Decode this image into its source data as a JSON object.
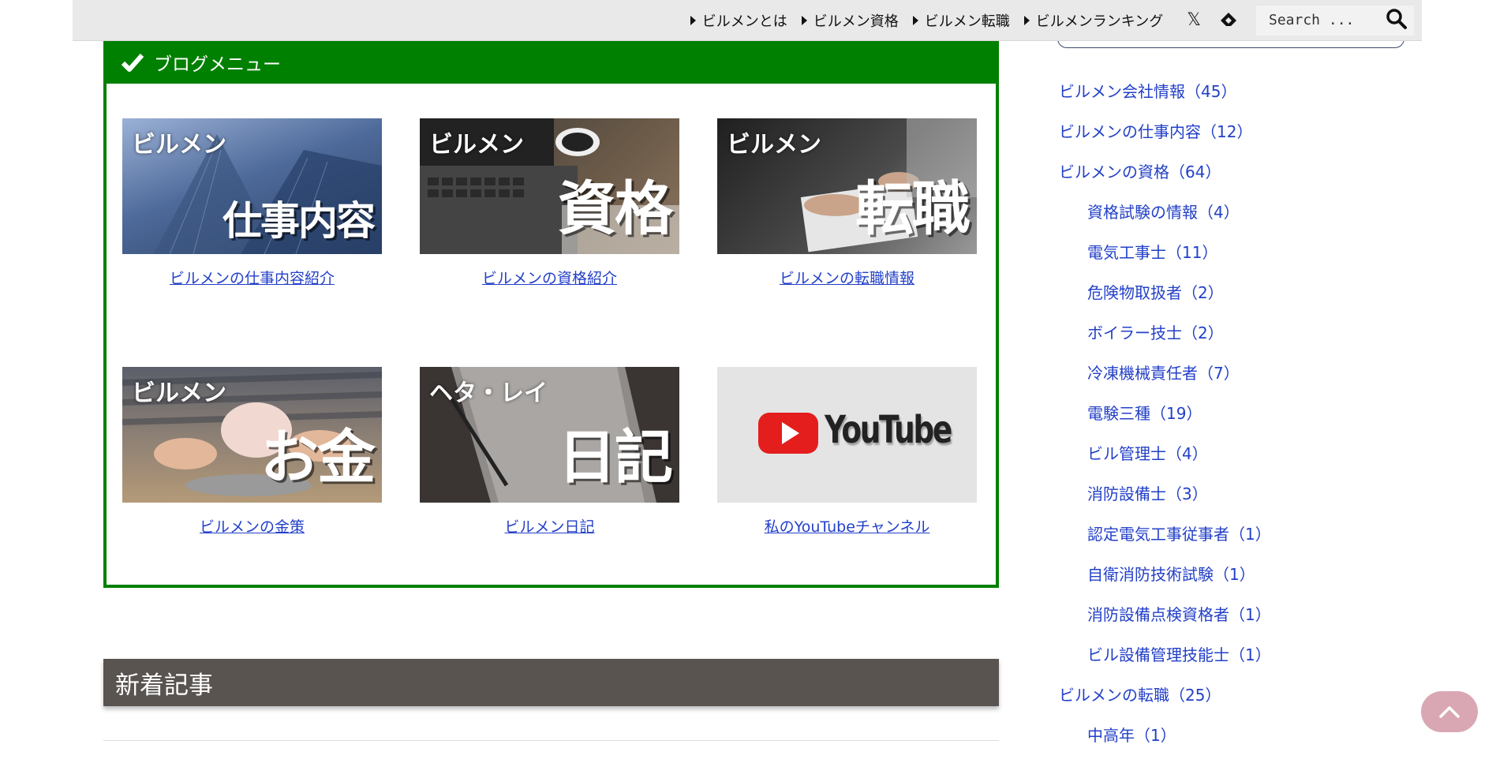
{
  "nav": {
    "items": [
      "ビルメンとは",
      "ビルメン資格",
      "ビルメン転職",
      "ビルメンランキング"
    ],
    "search_placeholder": "Search ..."
  },
  "blog_menu": {
    "title": "ブログメニュー",
    "cards": [
      {
        "small": "ビルメン",
        "big": "仕事内容",
        "link": "ビルメンの仕事内容紹介"
      },
      {
        "small": "ビルメン",
        "big": "資格",
        "link": "ビルメンの資格紹介"
      },
      {
        "small": "ビルメン",
        "big": "転職",
        "link": "ビルメンの転職情報"
      },
      {
        "small": "ビルメン",
        "big": "お金",
        "link": "ビルメンの金策"
      },
      {
        "small": "ヘタ・レイ",
        "big": "日記",
        "link": "ビルメン日記"
      },
      {
        "small": "",
        "big": "YouTube",
        "link": "私のYouTubeチャンネル"
      }
    ]
  },
  "new_articles": {
    "title": "新着記事"
  },
  "sidebar": {
    "categories": [
      {
        "label": "ビルメン会社情報（45）",
        "sub": false
      },
      {
        "label": "ビルメンの仕事内容（12）",
        "sub": false
      },
      {
        "label": "ビルメンの資格（64）",
        "sub": false
      },
      {
        "label": "資格試験の情報（4）",
        "sub": true
      },
      {
        "label": "電気工事士（11）",
        "sub": true
      },
      {
        "label": "危険物取扱者（2）",
        "sub": true
      },
      {
        "label": "ボイラー技士（2）",
        "sub": true
      },
      {
        "label": "冷凍機械責任者（7）",
        "sub": true
      },
      {
        "label": "電験三種（19）",
        "sub": true
      },
      {
        "label": "ビル管理士（4）",
        "sub": true
      },
      {
        "label": "消防設備士（3）",
        "sub": true
      },
      {
        "label": "認定電気工事従事者（1）",
        "sub": true
      },
      {
        "label": "自衛消防技術試験（1）",
        "sub": true
      },
      {
        "label": "消防設備点検資格者（1）",
        "sub": true
      },
      {
        "label": "ビル設備管理技能士（1）",
        "sub": true
      },
      {
        "label": "ビルメンの転職（25）",
        "sub": false
      },
      {
        "label": "中高年（1）",
        "sub": true
      }
    ]
  }
}
